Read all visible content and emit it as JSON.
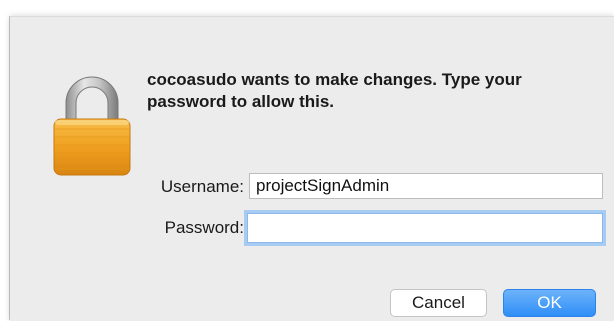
{
  "dialog": {
    "message": "cocoasudo wants to make changes. Type your password to allow this.",
    "icon": "lock-icon",
    "username_label": "Username:",
    "username_value": "projectSignAdmin",
    "password_label": "Password:",
    "password_value": "",
    "cancel_label": "Cancel",
    "ok_label": "OK"
  },
  "colors": {
    "dialog_background": "#ececec",
    "focus_ring": "#a8cbf2",
    "default_button": "#2f8ef7",
    "lock_body": "#f0a020"
  }
}
